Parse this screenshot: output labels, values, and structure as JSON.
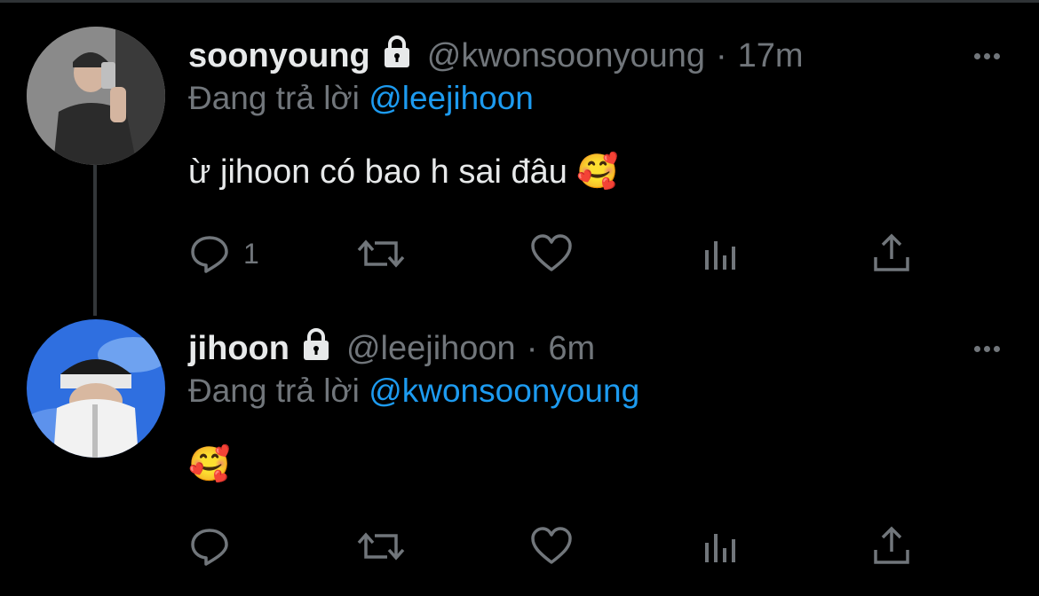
{
  "tweets": [
    {
      "name": "soonyoung",
      "handle": "@kwonsoonyoung",
      "separator": "·",
      "time": "17m",
      "replying_prefix": "Đang trả lời",
      "replying_to": "@leejihoon",
      "text": "ừ jihoon có bao h sai đâu 🥰",
      "reply_count": "1",
      "avatar_desc": "mirror-selfie-avatar"
    },
    {
      "name": "jihoon",
      "handle": "@leejihoon",
      "separator": "·",
      "time": "6m",
      "replying_prefix": "Đang trả lời",
      "replying_to": "@kwonsoonyoung",
      "text": "🥰",
      "reply_count": "",
      "avatar_desc": "sky-selfie-avatar"
    }
  ],
  "colors": {
    "background": "#000000",
    "muted": "#71767b",
    "accent": "#1d9bf0",
    "text": "#e7e9ea"
  }
}
